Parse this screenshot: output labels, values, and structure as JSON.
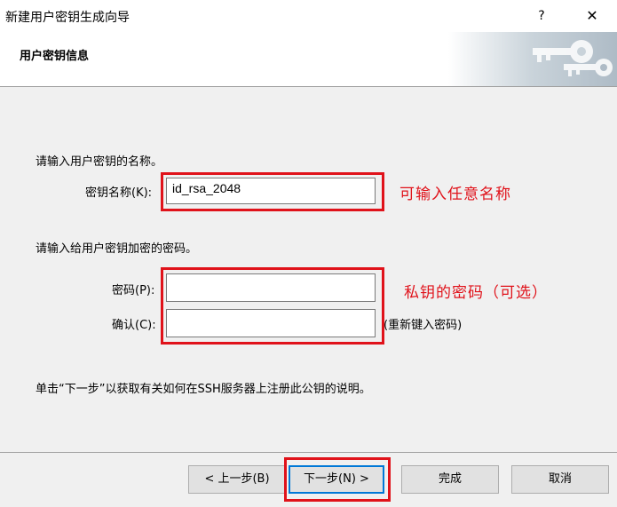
{
  "window": {
    "title": "新建用户密钥生成向导",
    "help_label": "?",
    "close_label": "✕"
  },
  "header": {
    "title": "用户密钥信息"
  },
  "section1": {
    "prompt": "请输入用户密钥的名称。",
    "name_label": "密钥名称(K):",
    "name_value": "id_rsa_2048"
  },
  "section2": {
    "prompt": "请输入给用户密钥加密的密码。",
    "password_label": "密码(P):",
    "password_value": "",
    "confirm_label": "确认(C):",
    "confirm_value": "",
    "confirm_hint": "(重新键入密码)"
  },
  "info": {
    "text": "单击“下一步”以获取有关如何在SSH服务器上注册此公钥的说明。"
  },
  "annotations": {
    "name_note": "可输入任意名称",
    "password_note": "私钥的密码（可选）"
  },
  "buttons": {
    "back": "< 上一步(B)",
    "next": "下一步(N) >",
    "finish": "完成",
    "cancel": "取消"
  },
  "colors": {
    "annotation_red": "#e0121a",
    "dialog_bg": "#f0f0f0"
  }
}
